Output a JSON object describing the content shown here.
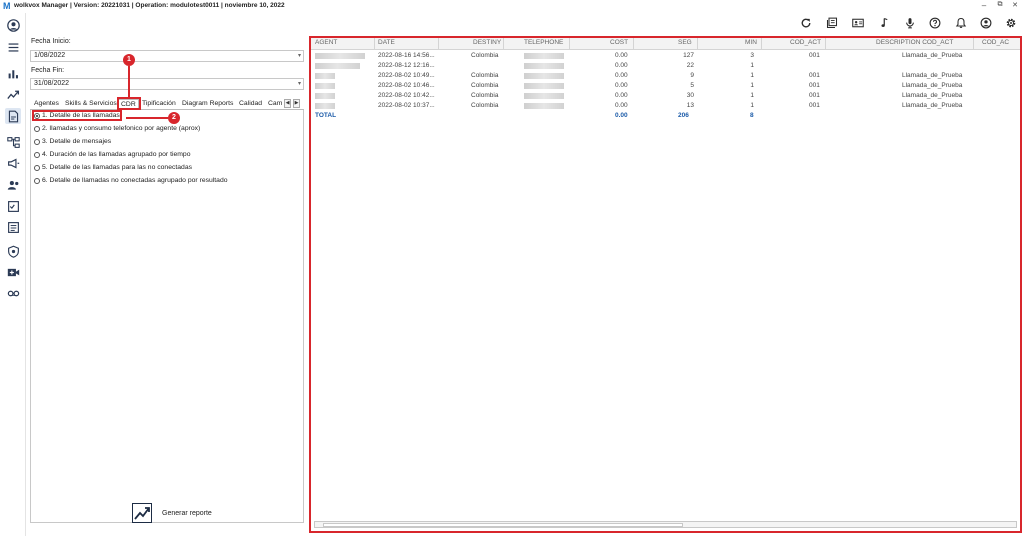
{
  "window": {
    "title": "wolkvox Manager  | Version: 20221031 |  Operation: modulotest0011 |  noviembre 10, 2022",
    "logo_letter": "M",
    "minimize": "–",
    "restore": "⧉",
    "close": "✕"
  },
  "filters": {
    "start_label": "Fecha Inicio:",
    "start_value": "1/08/2022",
    "end_label": "Fecha Fin:",
    "end_value": "31/08/2022"
  },
  "tabs": {
    "agentes": "Agentes",
    "skills": "Skills & Servicios",
    "cdr": "CDR",
    "tipificacion": "Tipificación",
    "diagram": "Diagram Reports",
    "calidad": "Calidad",
    "cam": "Cam"
  },
  "reports": [
    "1. Detalle de las llamadas",
    "2. llamadas y consumo telefonico por agente (aprox)",
    "3. Detalle de mensajes",
    "4. Duración de las llamadas agrupado por tiempo",
    "5. Detalle de las llamadas para las no conectadas",
    "6. Detalle de llamadas no conectadas agrupado por resultado"
  ],
  "selected_report": 1,
  "generate_label": "Generar reporte",
  "annotations": {
    "step1": "1",
    "step2": "2"
  },
  "table": {
    "headers": {
      "agent": "AGENT",
      "date": "DATE",
      "destiny": "DESTINY",
      "telephone": "TELEPHONE",
      "cost": "COST",
      "seg": "SEG",
      "min": "MIN",
      "cod_act": "COD_ACT",
      "description": "DESCRIPTION COD_ACT",
      "cod_act2": "COD_AC"
    },
    "rows": [
      {
        "date": "2022-08-16 14:56...",
        "destiny": "Colombia",
        "cost": "0.00",
        "seg": "127",
        "min": "3",
        "cod": "001",
        "desc": "Llamada_de_Prueba"
      },
      {
        "date": "2022-08-12 12:16...",
        "destiny": "",
        "cost": "0.00",
        "seg": "22",
        "min": "1",
        "cod": "",
        "desc": ""
      },
      {
        "date": "2022-08-02 10:49...",
        "destiny": "Colombia",
        "cost": "0.00",
        "seg": "9",
        "min": "1",
        "cod": "001",
        "desc": "Llamada_de_Prueba"
      },
      {
        "date": "2022-08-02 10:46...",
        "destiny": "Colombia",
        "cost": "0.00",
        "seg": "5",
        "min": "1",
        "cod": "001",
        "desc": "Llamada_de_Prueba"
      },
      {
        "date": "2022-08-02 10:42...",
        "destiny": "Colombia",
        "cost": "0.00",
        "seg": "30",
        "min": "1",
        "cod": "001",
        "desc": "Llamada_de_Prueba"
      },
      {
        "date": "2022-08-02 10:37...",
        "destiny": "Colombia",
        "cost": "0.00",
        "seg": "13",
        "min": "1",
        "cod": "001",
        "desc": "Llamada_de_Prueba"
      }
    ],
    "total": {
      "label": "TOTAL",
      "cost": "0.00",
      "seg": "206",
      "min": "8"
    }
  },
  "colors": {
    "accent": "#1a73c9",
    "highlight": "#d8262c",
    "total_text": "#1a5aa8"
  }
}
